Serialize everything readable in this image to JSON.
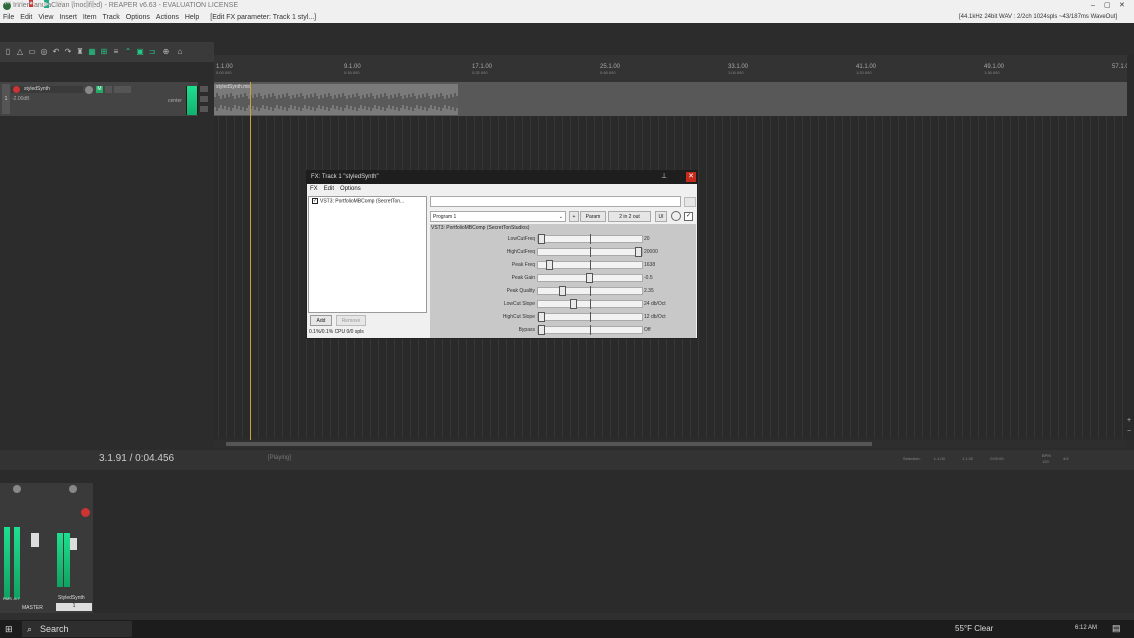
{
  "titlebar": {
    "title": "InnerCanulaClean (modified) - REAPER v6.63 - EVALUATION LICENSE",
    "format_info": "[44.1kHz 24bit WAV : 2/2ch 1024spls ~43/187ms WaveOut]"
  },
  "menubar": {
    "items": [
      "File",
      "Edit",
      "View",
      "Insert",
      "Item",
      "Track",
      "Options",
      "Actions",
      "Help"
    ],
    "status": "[Edit FX parameter: Track 1 styl...]"
  },
  "ruler": {
    "marks": [
      {
        "label": "1.1.00",
        "time": "0:00.000"
      },
      {
        "label": "9.1.00",
        "time": "0:16.000"
      },
      {
        "label": "17.1.00",
        "time": "0:32.000"
      },
      {
        "label": "25.1.00",
        "time": "0:48.000"
      },
      {
        "label": "33.1.00",
        "time": "1:04.000"
      },
      {
        "label": "41.1.00",
        "time": "1:20.000"
      },
      {
        "label": "49.1.00",
        "time": "1:36.000"
      },
      {
        "label": "57.1.00",
        "time": ""
      }
    ]
  },
  "track": {
    "number": "1",
    "name": "styledSynth",
    "volume": "-2.00dB",
    "pan": "center",
    "item_name": "styledSynth.mid"
  },
  "transport": {
    "time": "3.1.91 / 0:04.456",
    "state": "[Playing]",
    "selection_label": "Selection:",
    "selection_start": "1.1.00",
    "selection_end": "1.1.00",
    "selection_length": "0:00:00",
    "bpm_label": "BPM",
    "bpm": "120",
    "time_sig": "4/4"
  },
  "mixer": {
    "master_label": "MASTER",
    "master_rms": "RMS -6.7",
    "track_name": "StyledSynth",
    "track_number": "1"
  },
  "fx_window": {
    "title": "FX: Track 1 \"styledSynth\"",
    "menu": [
      "FX",
      "Edit",
      "Options"
    ],
    "chain_item": "VST3: PortfolioMBComp (SecretTon...",
    "add_label": "Add",
    "remove_label": "Remove",
    "cpu": "0.1%/0.1% CPU 0/0 spls",
    "program": "Program 1",
    "plus_label": "+",
    "param_label": "Param",
    "io_label": "2 in 2 out",
    "ui_label": "UI",
    "plugin_name": "VST3: PortfolioMBComp (SecretTonStudios)",
    "params": [
      {
        "name": "LowCutFreq",
        "value": "20",
        "level": 0.0
      },
      {
        "name": "HighCutFreq",
        "value": "20000",
        "level": 1.0
      },
      {
        "name": "Peak Freq",
        "value": "1638",
        "level": 0.08
      },
      {
        "name": "Peak Gain",
        "value": "-0.5",
        "level": 0.49
      },
      {
        "name": "Peak Quality",
        "value": "2.35",
        "level": 0.22
      },
      {
        "name": "LowCut Slope",
        "value": "24 db/Oct",
        "level": 0.33
      },
      {
        "name": "HighCut Slope",
        "value": "12 db/Oct",
        "level": 0.0
      },
      {
        "name": "Bypass",
        "value": "Off",
        "level": 0.0
      }
    ]
  },
  "taskbar": {
    "search": "Search",
    "weather": "55°F  Clear",
    "clock": "6:12 AM"
  }
}
